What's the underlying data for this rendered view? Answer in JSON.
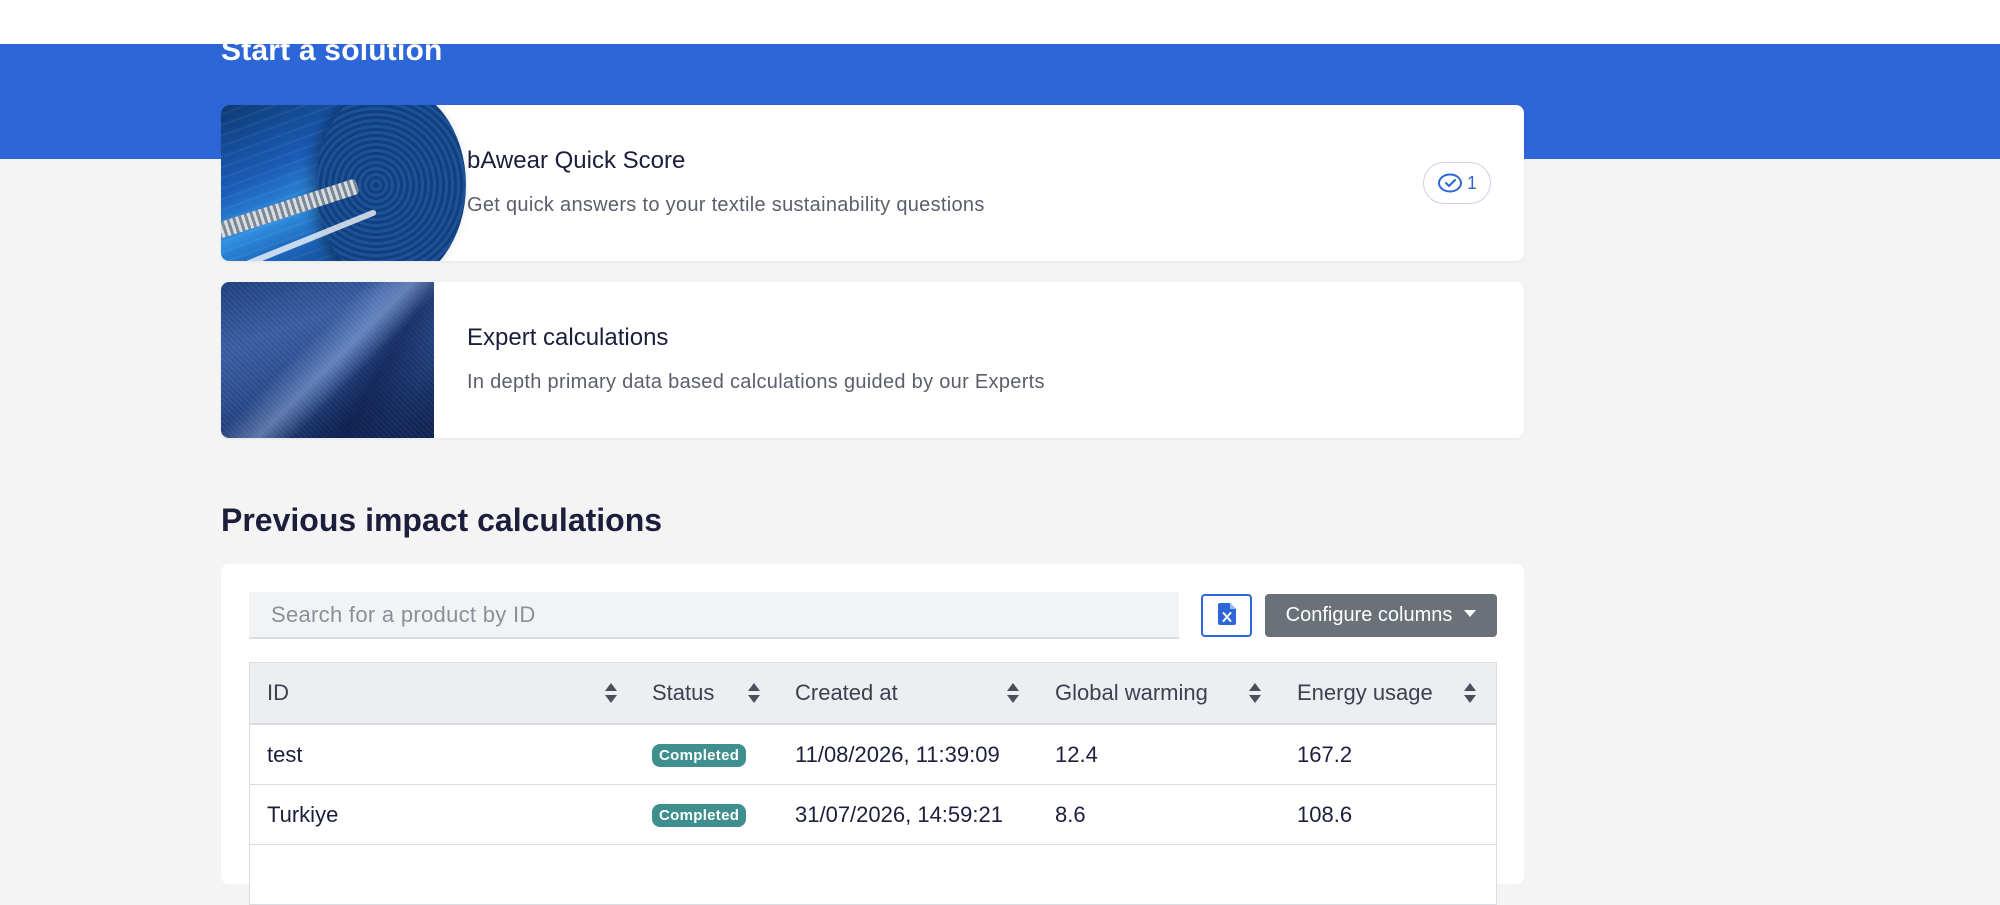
{
  "hero": {
    "title": "Start a solution"
  },
  "solutions": [
    {
      "title": "bAwear Quick Score",
      "description": "Get quick answers to your textile sustainability questions",
      "badge_count": "1",
      "badge_icon": "shield-check-icon"
    },
    {
      "title": "Expert calculations",
      "description": "In depth primary data based calculations guided by our Experts"
    }
  ],
  "calculations": {
    "title": "Previous impact calculations",
    "search_placeholder": "Search for a product by ID",
    "export_icon": "excel-file-icon",
    "configure_label": "Configure columns",
    "columns": [
      "ID",
      "Status",
      "Created at",
      "Global warming",
      "Energy usage"
    ],
    "rows": [
      {
        "id": "test",
        "status": "Completed",
        "created_at": "11/08/2026, 11:39:09",
        "global_warming": "12.4",
        "energy_usage": "167.2"
      },
      {
        "id": "Turkiye",
        "status": "Completed",
        "created_at": "31/07/2026, 14:59:21",
        "global_warming": "8.6",
        "energy_usage": "108.6"
      }
    ]
  },
  "colors": {
    "brand_blue": "#2d66d6",
    "status_completed": "#3f8f8f",
    "button_gray": "#6b7178"
  }
}
